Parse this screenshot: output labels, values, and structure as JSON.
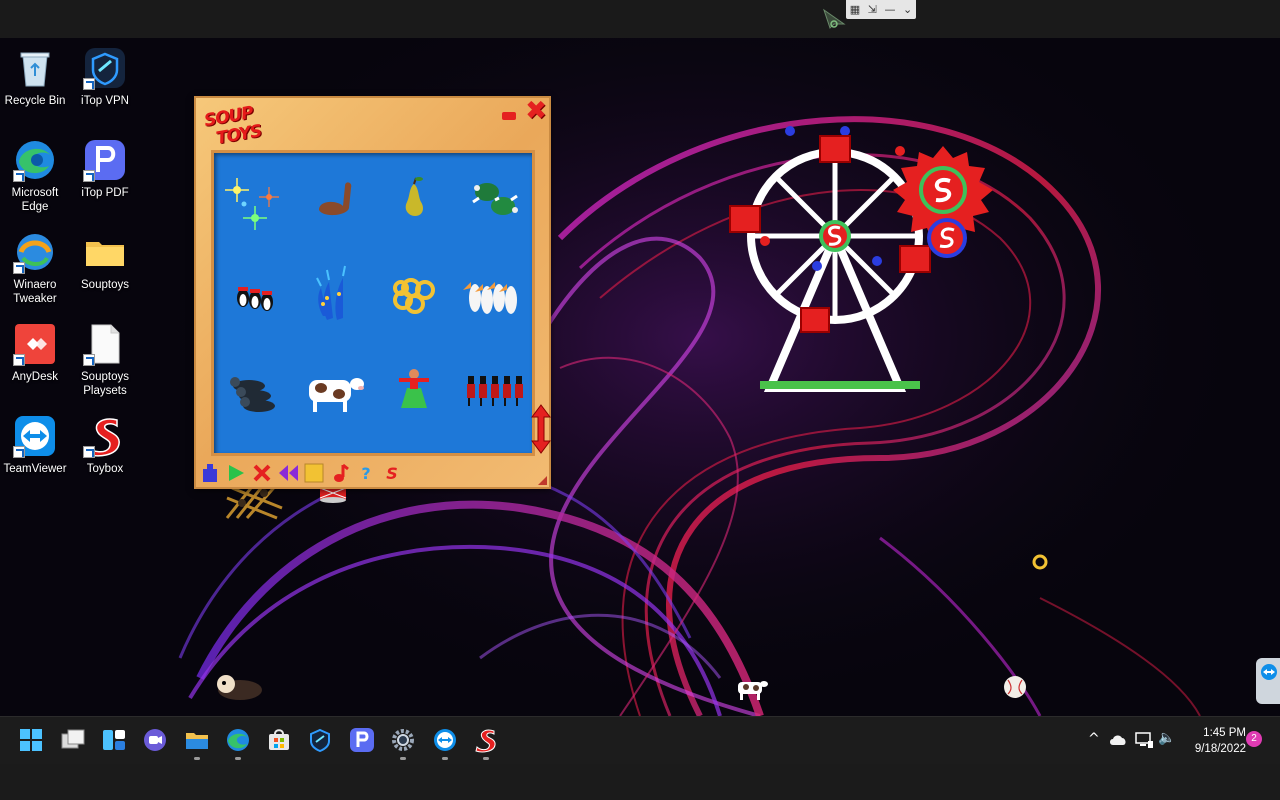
{
  "desktop": {
    "icons": [
      {
        "label": "Recycle Bin",
        "icon": "recycle-bin-icon"
      },
      {
        "label": "iTop VPN",
        "icon": "itop-vpn-icon"
      },
      {
        "label": "Microsoft Edge",
        "icon": "edge-icon"
      },
      {
        "label": "iTop PDF",
        "icon": "itop-pdf-icon"
      },
      {
        "label": "Winaero Tweaker",
        "icon": "winaero-icon"
      },
      {
        "label": "Souptoys",
        "icon": "folder-icon"
      },
      {
        "label": "AnyDesk",
        "icon": "anydesk-icon"
      },
      {
        "label": "Souptoys Playsets",
        "icon": "document-icon"
      },
      {
        "label": "TeamViewer",
        "icon": "teamviewer-icon"
      },
      {
        "label": "Toybox",
        "icon": "souptoys-s-icon"
      }
    ]
  },
  "soup_window": {
    "logo_line1": "SOUP",
    "logo_line2": "TOYS",
    "close_glyph": "✖",
    "toys": [
      {
        "name": "sparkles"
      },
      {
        "name": "duck-decoy"
      },
      {
        "name": "pear"
      },
      {
        "name": "turtles"
      },
      {
        "name": "penguins"
      },
      {
        "name": "peacocks"
      },
      {
        "name": "gold-rings"
      },
      {
        "name": "pelicans"
      },
      {
        "name": "seals"
      },
      {
        "name": "cow"
      },
      {
        "name": "hula-dancer"
      },
      {
        "name": "toy-soldiers"
      }
    ],
    "toolbar": [
      "drop",
      "play",
      "cancel",
      "rewind",
      "stop",
      "music",
      "help",
      "souptoys"
    ],
    "toolbar_glyphs": {
      "help": "?",
      "souptoys": "S"
    }
  },
  "remote_bar": {
    "grid": "▦",
    "restore": "⇲",
    "minimize": "—",
    "chevron": "⌄"
  },
  "taskbar": {
    "items": [
      "start",
      "task-view",
      "widgets",
      "teams-chat",
      "file-explorer",
      "edge",
      "microsoft-store",
      "itop-vpn",
      "itop-pdf",
      "settings",
      "teamviewer",
      "souptoys"
    ],
    "tray_glyphs": {
      "chevron": "^",
      "volume": "🔈"
    },
    "time": "1:45 PM",
    "date": "9/18/2022",
    "notifications": "2"
  },
  "colors": {
    "taskbar": "#1c1c1c",
    "wallpaper": "#07050d",
    "toy_grid": "#1e78d8",
    "window_wood": "#eaa85a",
    "accent_red": "#e52020"
  }
}
